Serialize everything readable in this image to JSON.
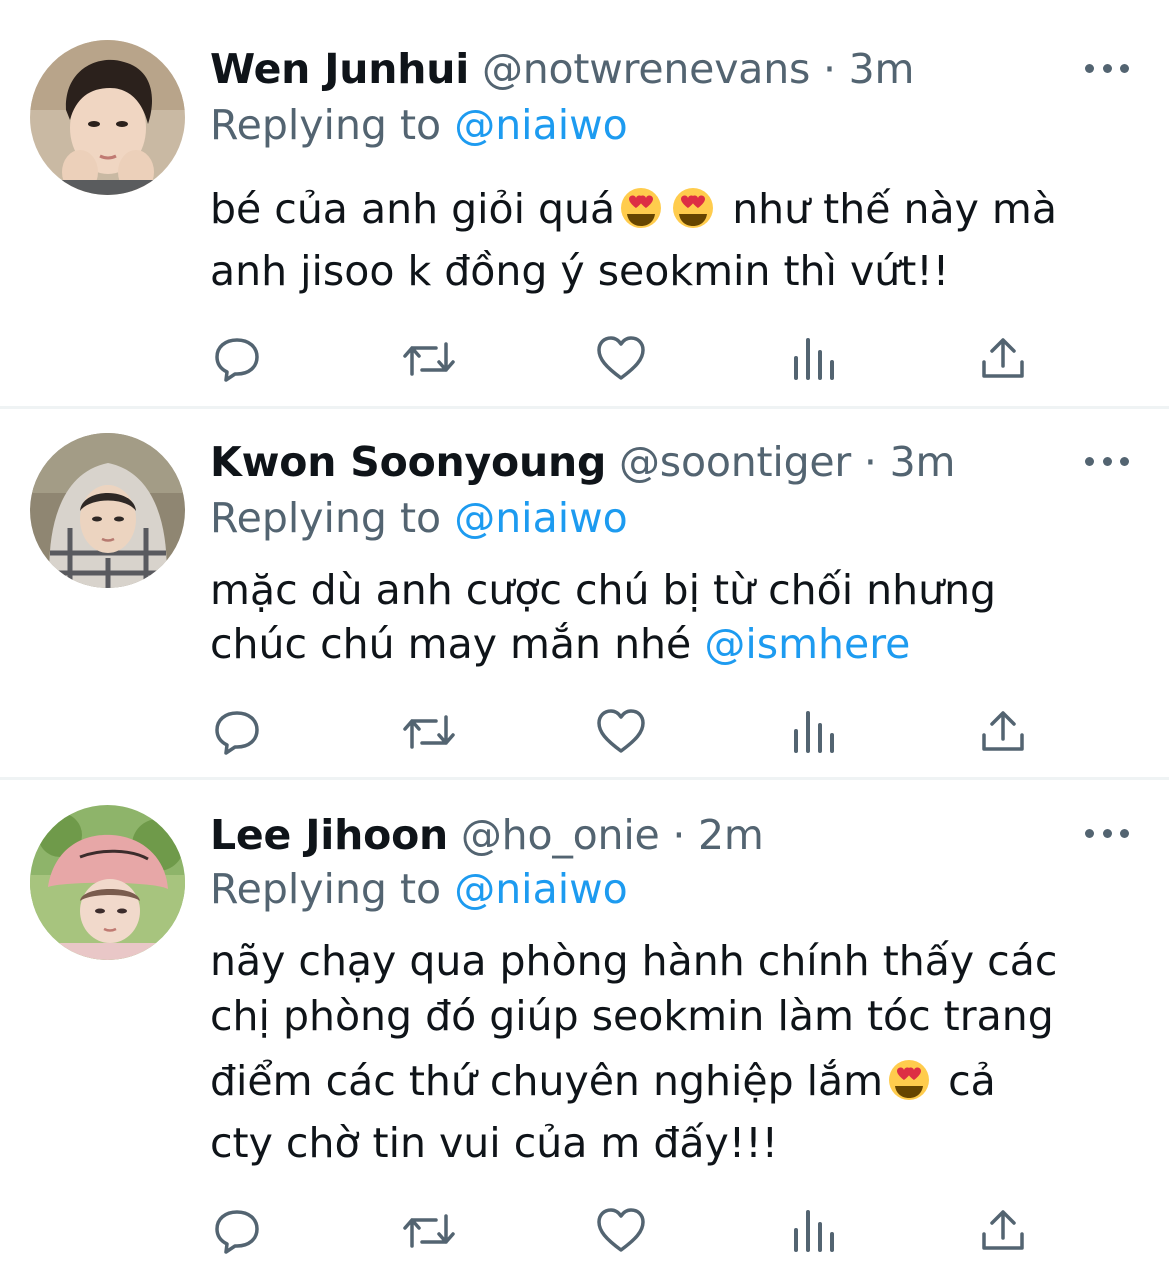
{
  "tweets": [
    {
      "name": "Wen Junhui",
      "meta": " @notwrenevans · 3m",
      "replying_prefix": "Replying to ",
      "replying_to": "@niaiwo",
      "line1_before": "bé của anh giỏi quá",
      "line1_after": " như thế này mà",
      "line2": "anh jisoo k đồng ý seokmin thì vứt!!"
    },
    {
      "name": "Kwon Soonyoung",
      "meta": " @soontiger · 3m",
      "replying_prefix": "Replying to ",
      "replying_to": "@niaiwo",
      "line1": "mặc dù anh cược chú bị từ chối nhưng",
      "line2_before": "chúc chú may mắn nhé ",
      "line2_mention": "@ismhere"
    },
    {
      "name": "Lee Jihoon",
      "meta": " @ho_onie · 2m",
      "replying_prefix": "Replying to ",
      "replying_to": "@niaiwo",
      "line1": "nãy chạy qua phòng hành chính thấy các",
      "line2": "chị phòng đó giúp seokmin làm tóc trang",
      "line3_before": "điểm các thứ chuyên nghiệp lắm",
      "line3_after": " cả",
      "line4": "cty chờ tin vui của m đấy!!!"
    }
  ],
  "icons": {
    "reply": "reply-icon",
    "retweet": "retweet-icon",
    "like": "heart-icon",
    "analytics": "analytics-icon",
    "share": "share-icon",
    "more": "more-icon",
    "emoji": "heart-eyes-emoji"
  },
  "colors": {
    "text": "#0f1419",
    "secondary": "#536471",
    "link": "#1d9bf0",
    "divider": "#eff3f4"
  }
}
